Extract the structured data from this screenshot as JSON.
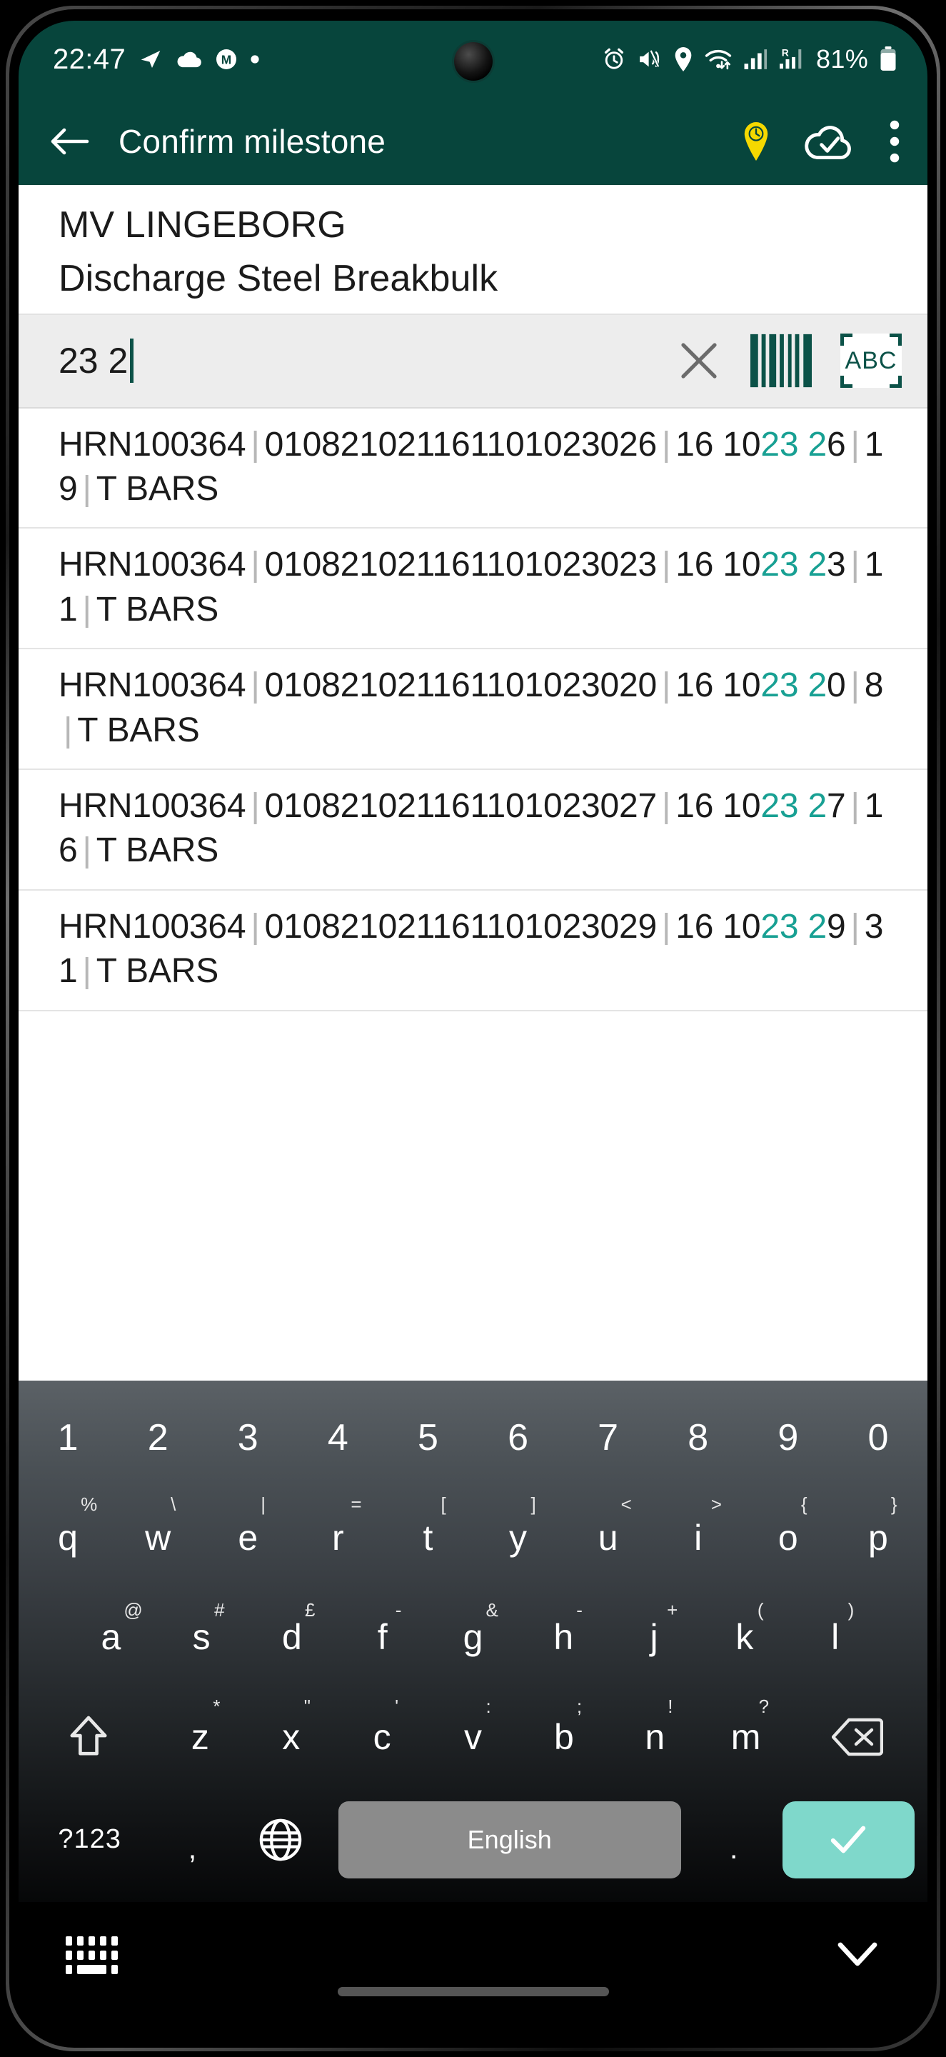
{
  "statusbar": {
    "time": "22:47",
    "left_icons": [
      "telegram-icon",
      "cloud-icon",
      "monzo-m-icon",
      "dot-icon"
    ],
    "right_icons": [
      "alarm-icon",
      "mute-vibrate-icon",
      "location-icon",
      "wifi-icon",
      "signal-icon",
      "roaming-signal-icon"
    ],
    "battery_percent": "81%"
  },
  "appbar": {
    "back_label": "back-arrow",
    "title": "Confirm milestone",
    "actions": [
      "location-time-pin-icon",
      "cloud-check-icon",
      "overflow-menu-icon"
    ],
    "accent_color": "#07453C",
    "pin_color": "#F5D800"
  },
  "header": {
    "vessel": "MV LINGEBORG",
    "operation": "Discharge Steel Breakbulk"
  },
  "search": {
    "value": "23 2",
    "placeholder": "",
    "clear_label": "clear-input",
    "barcode_label": "scan-barcode",
    "ocr_label": "ABC",
    "highlight_color": "#18a093"
  },
  "results": [
    {
      "ref": "HRN100364",
      "barcode": "010821021161101023026",
      "mark_prefix": "16 10",
      "mark_hl1": "23",
      "mark_mid": " ",
      "mark_hl2": "2",
      "mark_suffix": "6",
      "qty": "19",
      "product": "T BARS"
    },
    {
      "ref": "HRN100364",
      "barcode": "010821021161101023023",
      "mark_prefix": "16 10",
      "mark_hl1": "23",
      "mark_mid": " ",
      "mark_hl2": "2",
      "mark_suffix": "3",
      "qty": "11",
      "product": "T BARS"
    },
    {
      "ref": "HRN100364",
      "barcode": "010821021161101023020",
      "mark_prefix": "16 10",
      "mark_hl1": "23",
      "mark_mid": " ",
      "mark_hl2": "2",
      "mark_suffix": "0",
      "qty": "8",
      "product": "T BARS"
    },
    {
      "ref": "HRN100364",
      "barcode": "010821021161101023027",
      "mark_prefix": "16 10",
      "mark_hl1": "23",
      "mark_mid": " ",
      "mark_hl2": "2",
      "mark_suffix": "7",
      "qty": "16",
      "product": "T BARS"
    },
    {
      "ref": "HRN100364",
      "barcode": "010821021161101023029",
      "mark_prefix": "16 10",
      "mark_hl1": "23",
      "mark_mid": " ",
      "mark_hl2": "2",
      "mark_suffix": "9",
      "qty": "31",
      "product": "T BARS"
    }
  ],
  "keyboard": {
    "numbers": [
      "1",
      "2",
      "3",
      "4",
      "5",
      "6",
      "7",
      "8",
      "9",
      "0"
    ],
    "row1": [
      {
        "main": "q",
        "sup": "%"
      },
      {
        "main": "w",
        "sup": "\\"
      },
      {
        "main": "e",
        "sup": "|"
      },
      {
        "main": "r",
        "sup": "="
      },
      {
        "main": "t",
        "sup": "["
      },
      {
        "main": "y",
        "sup": "]"
      },
      {
        "main": "u",
        "sup": "<"
      },
      {
        "main": "i",
        "sup": ">"
      },
      {
        "main": "o",
        "sup": "{"
      },
      {
        "main": "p",
        "sup": "}"
      }
    ],
    "row2": [
      {
        "main": "a",
        "sup": "@"
      },
      {
        "main": "s",
        "sup": "#"
      },
      {
        "main": "d",
        "sup": "£"
      },
      {
        "main": "f",
        "sup": "-"
      },
      {
        "main": "g",
        "sup": "&"
      },
      {
        "main": "h",
        "sup": "-"
      },
      {
        "main": "j",
        "sup": "+"
      },
      {
        "main": "k",
        "sup": "("
      },
      {
        "main": "l",
        "sup": ")"
      }
    ],
    "row3": [
      {
        "main": "z",
        "sup": "*"
      },
      {
        "main": "x",
        "sup": "\""
      },
      {
        "main": "c",
        "sup": "'"
      },
      {
        "main": "v",
        "sup": ":"
      },
      {
        "main": "b",
        "sup": ";"
      },
      {
        "main": "n",
        "sup": "!"
      },
      {
        "main": "m",
        "sup": "?"
      }
    ],
    "shift_label": "shift-key",
    "backspace_label": "backspace-key",
    "symbols_label": "?123",
    "comma_label": ",",
    "globe_label": "language-globe",
    "space_label": "English",
    "period_label": ".",
    "enter_label": "enter-confirm",
    "enter_color": "#7fd8cb"
  },
  "navbar": {
    "keyboard_icon_label": "show-keyboard",
    "hide_keyboard_label": "hide-keyboard",
    "gesture_bar_label": "gesture-handle"
  }
}
